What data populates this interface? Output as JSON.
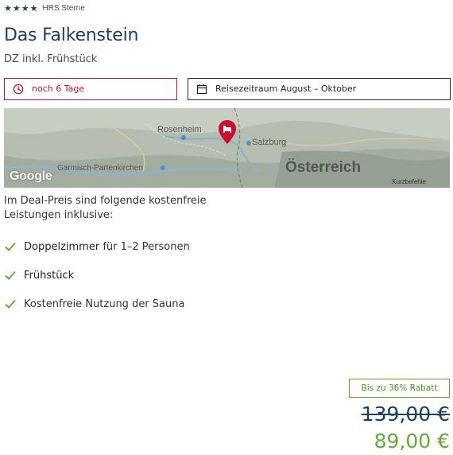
{
  "rating": {
    "stars": "★★★★",
    "label": "HRS Sterne"
  },
  "hotel": {
    "name": "Das Falkenstein",
    "room": "DZ inkl. Frühstück"
  },
  "tags": {
    "countdown": "noch 6 Tage",
    "travel": "Reisezeitraum August – Oktober"
  },
  "map": {
    "cities": {
      "rosenheim": "Rosenheim",
      "salzburg": "Salzburg",
      "garmisch": "Garmisch-Partenkirchen"
    },
    "country": "Österreich",
    "provider": "Google",
    "shortcuts": "Kurzbefehle"
  },
  "intro": "Im Deal-Preis sind folgende kostenfreie Leistungen inklusive:",
  "features": [
    {
      "bold": "Doppelzimmer",
      "rest": " für 1–2 Personen"
    },
    {
      "bold": "Frühstück",
      "rest": ""
    },
    {
      "bold": "",
      "rest": "Kostenfreie Nutzung der Sauna"
    }
  ],
  "pricing": {
    "discount": "Bis zu 36% Rabatt",
    "old_price": "139,00 €",
    "new_price": "89,00 €"
  },
  "colors": {
    "brand_blue": "#1c3e5f",
    "alert_red": "#c8102e",
    "success_green": "#6aa83d"
  },
  "icons": {
    "star": "star-icon",
    "clock": "clock-icon",
    "calendar": "calendar-icon",
    "check": "check-icon",
    "map_marker": "map-marker-icon"
  }
}
